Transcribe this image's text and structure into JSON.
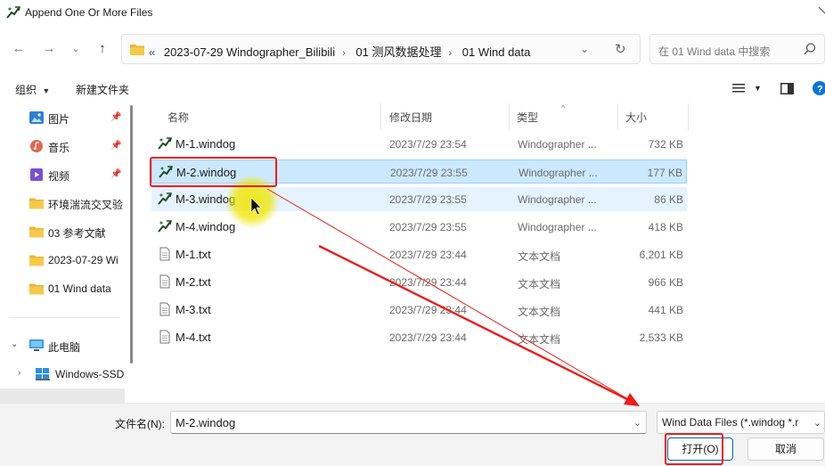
{
  "window": {
    "title": "Append One Or More Files"
  },
  "address": {
    "crumbs": [
      "2023-07-29 Windographer_Bilibili",
      "01 测风数据处理",
      "01 Wind data"
    ],
    "overflow": "«"
  },
  "search": {
    "placeholder": "在 01 Wind data 中搜索"
  },
  "toolbar": {
    "organize": "组织",
    "new_folder": "新建文件夹"
  },
  "sidebar": {
    "items": [
      {
        "label": "图片",
        "icon": "pictures-icon",
        "pinned": true
      },
      {
        "label": "音乐",
        "icon": "music-icon",
        "pinned": true
      },
      {
        "label": "视频",
        "icon": "video-icon",
        "pinned": true
      },
      {
        "label": "环境湍流交叉验",
        "icon": "folder-icon",
        "pinned": false
      },
      {
        "label": "03 参考文献",
        "icon": "folder-icon",
        "pinned": false
      },
      {
        "label": "2023-07-29 Wi",
        "icon": "folder-icon",
        "pinned": false
      },
      {
        "label": "01 Wind data",
        "icon": "folder-icon",
        "pinned": false
      },
      {
        "label": "此电脑",
        "icon": "computer-icon",
        "pinned": false
      },
      {
        "label": "Windows-SSD",
        "icon": "drive-icon",
        "pinned": false
      }
    ]
  },
  "columns": {
    "name": "名称",
    "date": "修改日期",
    "type": "类型",
    "size": "大小"
  },
  "files": [
    {
      "name": "M-1.windog",
      "date": "2023/7/29 23:54",
      "type": "Windographer ...",
      "size": "732 KB",
      "kind": "windog"
    },
    {
      "name": "M-2.windog",
      "date": "2023/7/29 23:55",
      "type": "Windographer ...",
      "size": "177 KB",
      "kind": "windog"
    },
    {
      "name": "M-3.windog",
      "date": "2023/7/29 23:55",
      "type": "Windographer ...",
      "size": "86 KB",
      "kind": "windog"
    },
    {
      "name": "M-4.windog",
      "date": "2023/7/29 23:55",
      "type": "Windographer ...",
      "size": "418 KB",
      "kind": "windog"
    },
    {
      "name": "M-1.txt",
      "date": "2023/7/29 23:44",
      "type": "文本文档",
      "size": "6,201 KB",
      "kind": "txt"
    },
    {
      "name": "M-2.txt",
      "date": "2023/7/29 23:44",
      "type": "文本文档",
      "size": "966 KB",
      "kind": "txt"
    },
    {
      "name": "M-3.txt",
      "date": "2023/7/29 23:44",
      "type": "文本文档",
      "size": "441 KB",
      "kind": "txt"
    },
    {
      "name": "M-4.txt",
      "date": "2023/7/29 23:44",
      "type": "文本文档",
      "size": "2,533 KB",
      "kind": "txt"
    }
  ],
  "selected_file": "M-2.windog",
  "footer": {
    "filename_label": "文件名(N):",
    "filename_value": "M-2.windog",
    "filter_value": "Wind Data Files (*.windog *.r",
    "open_label": "打开(O)",
    "cancel_label": "取消"
  },
  "colors": {
    "selection": "#cce8ff",
    "hover": "#e5f3ff",
    "annotation": "#f01a1a",
    "highlight": "#f0e600"
  }
}
